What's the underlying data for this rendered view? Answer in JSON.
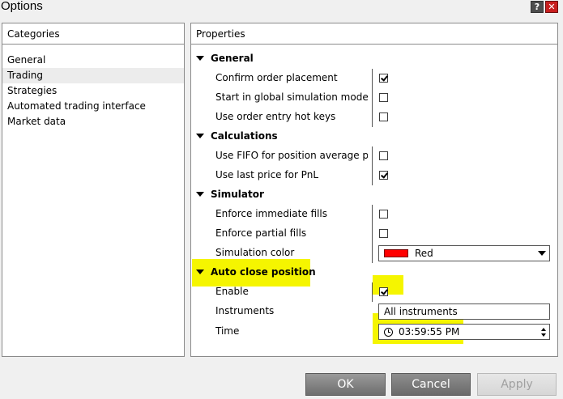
{
  "window": {
    "title": "Options",
    "help_label": "?",
    "close_label": "✕"
  },
  "categories": {
    "header": "Categories",
    "items": [
      {
        "label": "General"
      },
      {
        "label": "Trading"
      },
      {
        "label": "Strategies"
      },
      {
        "label": "Automated trading interface"
      },
      {
        "label": "Market data"
      }
    ],
    "selected": "Trading"
  },
  "properties": {
    "header": "Properties",
    "general": {
      "title": "General",
      "confirm_order_placement": {
        "label": "Confirm order placement",
        "checked": true
      },
      "start_global_sim": {
        "label": "Start in global simulation mode",
        "checked": false
      },
      "use_order_entry_hotkeys": {
        "label": "Use order entry hot keys",
        "checked": false
      }
    },
    "calculations": {
      "title": "Calculations",
      "use_fifo": {
        "label": "Use FIFO for position average p...",
        "checked": false
      },
      "use_last_price": {
        "label": "Use last price for PnL",
        "checked": true
      }
    },
    "simulator": {
      "title": "Simulator",
      "enforce_immediate": {
        "label": "Enforce immediate fills",
        "checked": false
      },
      "enforce_partial": {
        "label": "Enforce partial fills",
        "checked": false
      },
      "simulation_color": {
        "label": "Simulation color",
        "value": "Red",
        "swatch": "#ff0000"
      }
    },
    "auto_close": {
      "title": "Auto close position",
      "enable": {
        "label": "Enable",
        "checked": true
      },
      "instruments": {
        "label": "Instruments",
        "value": "All instruments"
      },
      "time": {
        "label": "Time",
        "value": "03:59:55 PM"
      }
    }
  },
  "buttons": {
    "ok": "OK",
    "cancel": "Cancel",
    "apply": "Apply"
  },
  "colors": {
    "highlight": "#f5f500",
    "selected_row": "#ececec"
  }
}
